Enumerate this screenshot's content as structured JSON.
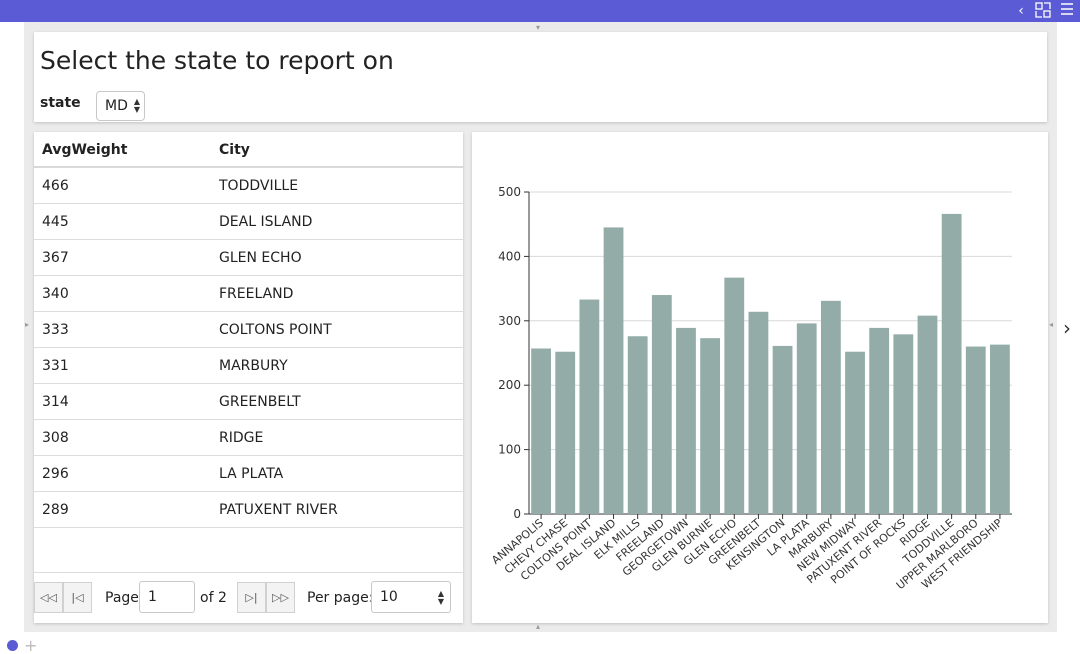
{
  "topbar": {
    "icons": [
      "chevron-left-icon",
      "layout-icon",
      "menu-icon"
    ],
    "accent": "#5b5bd6"
  },
  "header": {
    "title": "Select the state to report on",
    "state_label": "state",
    "state_value": "MD"
  },
  "table": {
    "columns": [
      "AvgWeight",
      "City"
    ],
    "rows": [
      [
        "466",
        "TODDVILLE"
      ],
      [
        "445",
        "DEAL ISLAND"
      ],
      [
        "367",
        "GLEN ECHO"
      ],
      [
        "340",
        "FREELAND"
      ],
      [
        "333",
        "COLTONS POINT"
      ],
      [
        "331",
        "MARBURY"
      ],
      [
        "314",
        "GREENBELT"
      ],
      [
        "308",
        "RIDGE"
      ],
      [
        "296",
        "LA PLATA"
      ],
      [
        "289",
        "PATUXENT RIVER"
      ]
    ]
  },
  "pager": {
    "page_label": "Page",
    "page_value": "1",
    "of_label": "of 2",
    "per_page_label": "Per page:",
    "per_page_value": "10"
  },
  "chart_data": {
    "type": "bar",
    "categories": [
      "ANNAPOLIS",
      "CHEVY CHASE",
      "COLTONS POINT",
      "DEAL ISLAND",
      "ELK MILLS",
      "FREELAND",
      "GEORGETOWN",
      "GLEN BURNIE",
      "GLEN ECHO",
      "GREENBELT",
      "KENSINGTON",
      "LA PLATA",
      "MARBURY",
      "NEW MIDWAY",
      "PATUXENT RIVER",
      "POINT OF ROCKS",
      "RIDGE",
      "TODDVILLE",
      "UPPER MARLBORO",
      "WEST FRIENDSHIP"
    ],
    "values": [
      257,
      252,
      333,
      445,
      276,
      340,
      289,
      273,
      367,
      314,
      261,
      296,
      331,
      252,
      289,
      279,
      308,
      466,
      260,
      263
    ],
    "yticks": [
      "0",
      "100",
      "200",
      "300",
      "400",
      "500"
    ],
    "ylim": [
      0,
      500
    ],
    "grid": true,
    "bar_color": "#93aca8"
  }
}
